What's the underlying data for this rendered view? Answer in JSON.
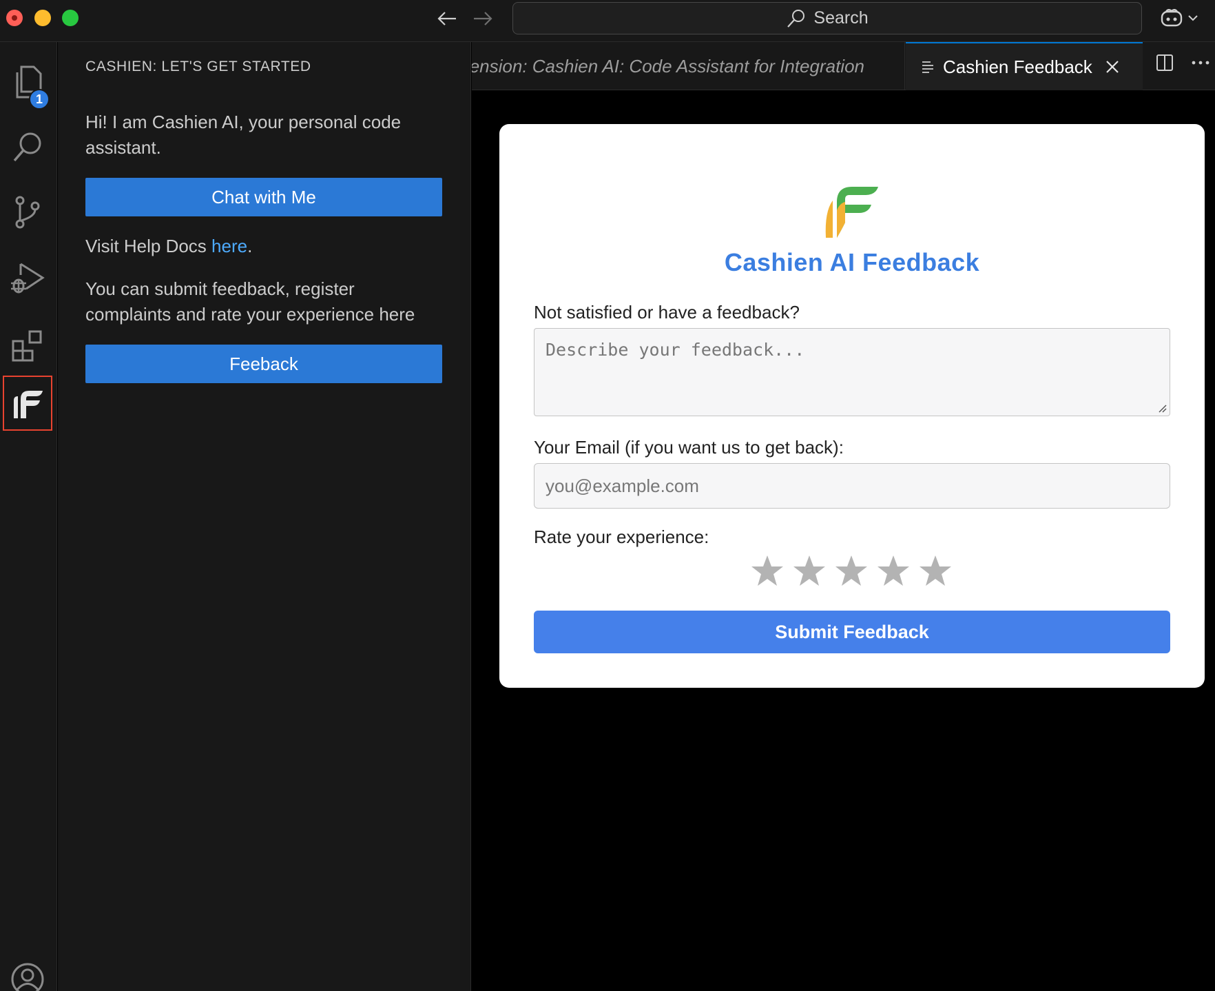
{
  "window": {
    "search_label": "Search"
  },
  "sidebar": {
    "title": "CASHIEN: LET'S GET STARTED",
    "intro": "Hi! I am Cashien AI, your personal code assistant.",
    "chat_button": "Chat with Me",
    "help_prefix": "Visit Help Docs ",
    "help_link": "here",
    "help_suffix": ".",
    "submit_text": "You can submit feedback, register complaints and rate your experience here",
    "feedback_button": "Feeback"
  },
  "activity_bar": {
    "explorer_badge": "1",
    "items": [
      "explorer-icon",
      "search-icon",
      "source-control-icon",
      "run-debug-icon",
      "extensions-icon",
      "cashien-icon",
      "account-icon"
    ]
  },
  "tabs": {
    "inactive_label": "Extension: Cashien AI: Code Assistant for Integration",
    "active_label": "Cashien Feedback"
  },
  "feedback_form": {
    "title": "Cashien AI Feedback",
    "feedback_label": "Not satisfied or have a feedback?",
    "feedback_placeholder": "Describe your feedback...",
    "email_label": "Your Email (if you want us to get back):",
    "email_placeholder": "you@example.com",
    "rating_label": "Rate your experience:",
    "rating_value": 0,
    "rating_max": 5,
    "submit_label": "Submit Feedback"
  },
  "colors": {
    "accent_blue": "#2b79d6",
    "form_title": "#3b7ee0",
    "submit_button": "#4580ea",
    "logo_green": "#4caf50",
    "logo_orange": "#f2b134",
    "selection_border": "#e8432f"
  }
}
